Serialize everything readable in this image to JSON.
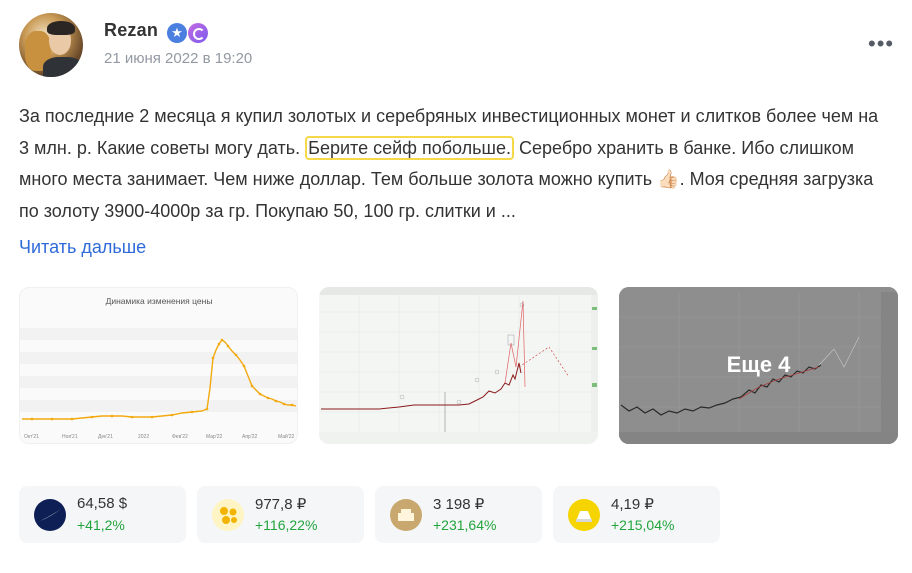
{
  "post": {
    "author": "Rezan",
    "date": "21 июня 2022 в 19:20",
    "text_before": "За последние 2 месяца я купил золотых и серебряных инвестиционных монет и слитков более чем на 3 млн. р. Какие советы могу дать. ",
    "highlight": "Берите сейф побольше.",
    "text_after": " Серебро хранить в банке. Ибо слишком много места занимает. Чем ниже доллар. Тем больше золота можно купить 👍🏻. Моя средняя загрузка по золоту 3900-4000р за гр. Покупаю 50, 100 гр. слитки и ...",
    "read_more": "Читать дальше",
    "more_icon": "more-icon"
  },
  "gallery": {
    "chart1": {
      "title": "Динамика изменения цены",
      "x_labels": [
        "Окт'21",
        "Ноя'21",
        "Дек'21",
        "2022",
        "Фев'22",
        "Мар'22",
        "Апр'22",
        "Май'22"
      ]
    },
    "more_label": "Еще 4"
  },
  "assets": [
    {
      "price": "64,58 $",
      "change": "+41,2%",
      "icon": "us-dollar-icon"
    },
    {
      "price": "977,8 ₽",
      "change": "+116,22%",
      "icon": "palladium-icon"
    },
    {
      "price": "3 198 ₽",
      "change": "+231,64%",
      "icon": "gold-bar-icon"
    },
    {
      "price": "4,19 ₽",
      "change": "+215,04%",
      "icon": "silver-bar-icon"
    }
  ],
  "colors": {
    "accent_link": "#2f6ad9",
    "positive": "#22a53d",
    "highlight_border": "#f5d94a"
  }
}
